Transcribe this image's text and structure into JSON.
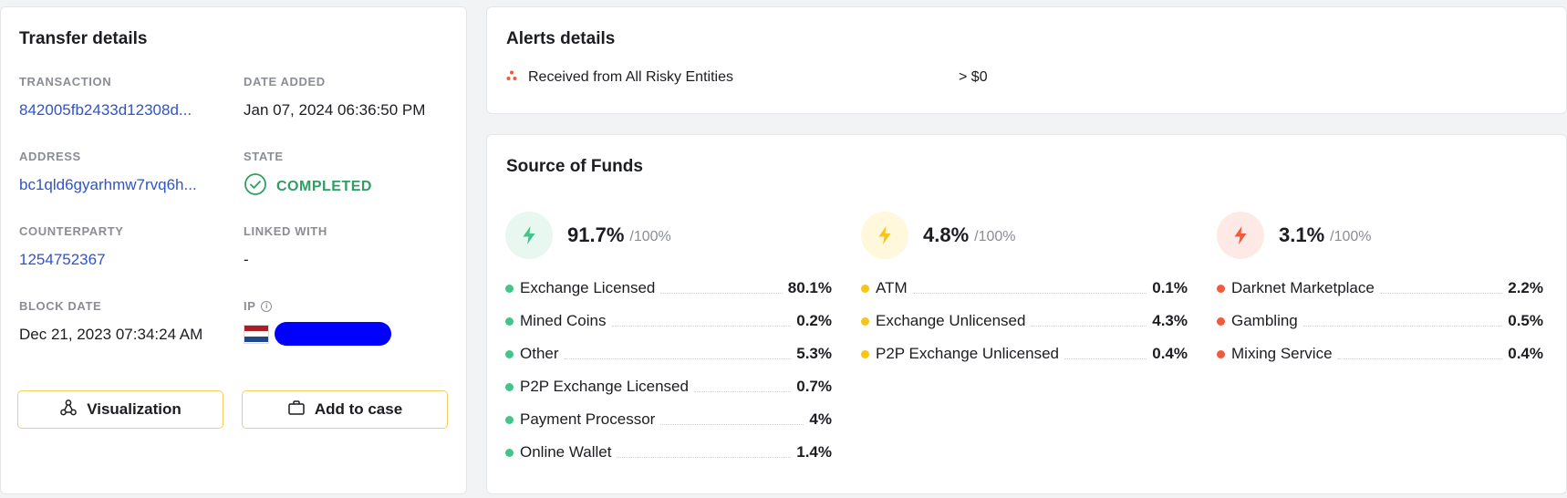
{
  "colors": {
    "green": "#44c48a",
    "yellow": "#f5c518",
    "red": "#f25a3c",
    "link": "#2f54c8",
    "completed": "#2e9e63"
  },
  "transfer": {
    "title": "Transfer details",
    "transaction_label": "TRANSACTION",
    "transaction_value": "842005fb2433d12308d...",
    "date_added_label": "DATE ADDED",
    "date_added_value": "Jan 07, 2024 06:36:50 PM",
    "address_label": "ADDRESS",
    "address_value": "bc1qld6gyarhmw7rvq6h...",
    "state_label": "STATE",
    "state_value": "COMPLETED",
    "counterparty_label": "COUNTERPARTY",
    "counterparty_value": "1254752367",
    "linked_label": "LINKED WITH",
    "linked_value": "-",
    "block_date_label": "BLOCK DATE",
    "block_date_value": "Dec 21, 2023 07:34:24 AM",
    "ip_label": "IP",
    "visualization_label": "Visualization",
    "add_to_case_label": "Add to case"
  },
  "alerts": {
    "title": "Alerts details",
    "items": [
      {
        "name": "Received from All Risky Entities",
        "condition": "> $0"
      }
    ]
  },
  "sof": {
    "title": "Source of Funds",
    "groups": [
      {
        "pct": "91.7%",
        "total": "/100%",
        "items": [
          {
            "name": "Exchange Licensed",
            "value": "80.1%"
          },
          {
            "name": "Mined Coins",
            "value": "0.2%"
          },
          {
            "name": "Other",
            "value": "5.3%"
          },
          {
            "name": "P2P Exchange Licensed",
            "value": "0.7%"
          },
          {
            "name": "Payment Processor",
            "value": "4%"
          },
          {
            "name": "Online Wallet",
            "value": "1.4%"
          }
        ]
      },
      {
        "pct": "4.8%",
        "total": "/100%",
        "items": [
          {
            "name": "ATM",
            "value": "0.1%"
          },
          {
            "name": "Exchange Unlicensed",
            "value": "4.3%"
          },
          {
            "name": "P2P Exchange Unlicensed",
            "value": "0.4%"
          }
        ]
      },
      {
        "pct": "3.1%",
        "total": "/100%",
        "items": [
          {
            "name": "Darknet Marketplace",
            "value": "2.2%"
          },
          {
            "name": "Gambling",
            "value": "0.5%"
          },
          {
            "name": "Mixing Service",
            "value": "0.4%"
          }
        ]
      }
    ]
  }
}
